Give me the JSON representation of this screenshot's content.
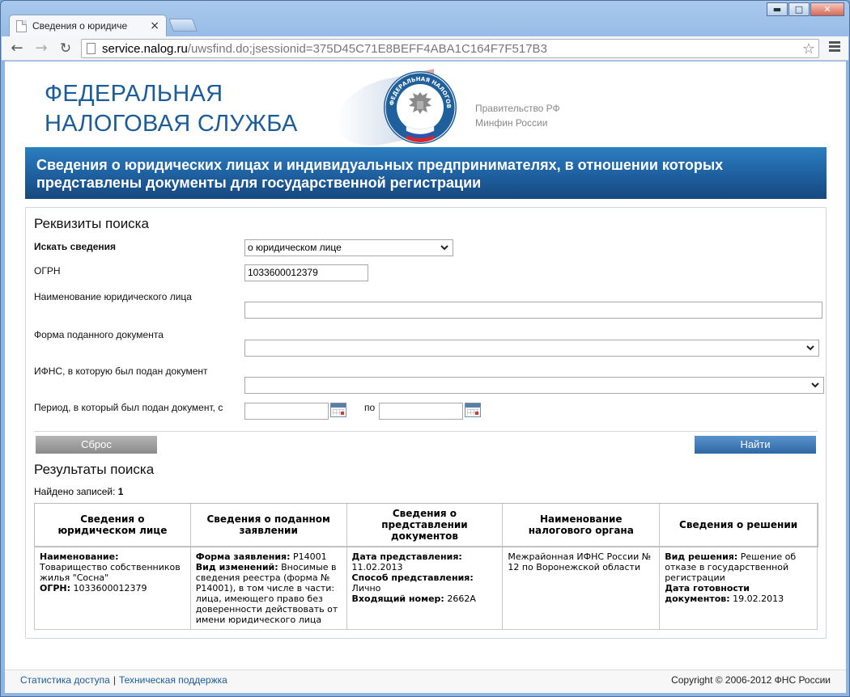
{
  "browser": {
    "tab_title": "Сведения о юридиче",
    "tab_close": "×",
    "url_host": "service.nalog.ru",
    "url_path": "/uwsfind.do;jsessionid=375D45C71E8BEFF4ABA1C164F7F517B3",
    "window_controls": {
      "minimize": "▬",
      "maximize": "□",
      "close": "✕"
    },
    "nav": {
      "back": "←",
      "forward": "→",
      "reload": "↻",
      "star": "☆"
    }
  },
  "header": {
    "brand_line1": "ФЕДЕРАЛЬНАЯ",
    "brand_line2": "НАЛОГОВАЯ СЛУЖБА",
    "emblem_text": "ФЕДЕРАЛЬНАЯ НАЛОГОВАЯ СЛУЖБА",
    "gov_link1": "Правительство РФ",
    "gov_link2": "Минфин России"
  },
  "banner": {
    "line1": "Сведения о юридических лицах и индивидуальных предпринимателях, в отношении которых",
    "line2": "представлены документы для государственной регистрации"
  },
  "search": {
    "title": "Реквизиты поиска",
    "search_for_label": "Искать сведения",
    "search_for_value": "о юридическом лице",
    "ogrn_label": "ОГРН",
    "ogrn_value": "1033600012379",
    "name_label": "Наименование юридического лица",
    "name_value": "",
    "doc_form_label": "Форма поданного документа",
    "doc_form_value": "",
    "ifns_label": "ИФНС, в которую был подан документ",
    "ifns_value": "",
    "period_label": "Период, в который был подан документ, с",
    "period_to_label": "по",
    "period_from_value": "",
    "period_to_value": "",
    "reset_label": "Сброс",
    "find_label": "Найти"
  },
  "results": {
    "title": "Результаты поиска",
    "found_label": "Найдено записей:",
    "found_count": "1",
    "columns": [
      "Сведения о юридическом лице",
      "Сведения о поданном заявлении",
      "Сведения о представлении документов",
      "Наименование налогового органа",
      "Сведения о решении"
    ],
    "row": {
      "name_label": "Наименование:",
      "name_value": "Товарищество собственников жилья \"Сосна\"",
      "ogrn_label": "ОГРН:",
      "ogrn_value": "1033600012379",
      "form_label": "Форма заявления:",
      "form_value": "Р14001",
      "change_label": "Вид изменений:",
      "change_value": "Вносимые в сведения реестра (форма № Р14001), в том числе в части: лица, имеющего право без доверенности действовать от имени юридического лица",
      "date_label": "Дата представления:",
      "date_value": "11.02.2013",
      "method_label": "Способ представления:",
      "method_value": "Лично",
      "incoming_label": "Входящий номер:",
      "incoming_value": "2662А",
      "authority": "Межрайонная ИФНС России № 12 по Воронежской области",
      "decision_label": "Вид решения:",
      "decision_value": "Решение об отказе в государственной регистрации",
      "ready_label": "Дата готовности документов:",
      "ready_value": "19.02.2013"
    }
  },
  "footer": {
    "stats_link": "Статистика доступа",
    "separator": "|",
    "support_link": "Техническая поддержка",
    "copyright": "Copyright © 2006-2012 ФНС России"
  },
  "colors": {
    "brand_blue": "#1b5c9a",
    "banner_blue": "#1e5f9f",
    "find_button": "#2e67a6",
    "reset_button": "#8a8a8a"
  }
}
